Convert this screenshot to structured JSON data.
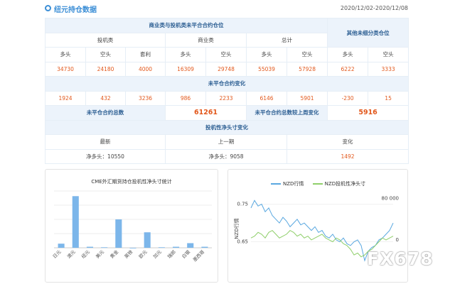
{
  "header": {
    "title": "纽元持仓数据",
    "date_range": "2020/12/02-2020/12/08"
  },
  "table": {
    "title_commercial_noncommercial": "商业类与投机类未平合合约仓位",
    "title_other": "其他未细分类仓位",
    "groups": {
      "speculative": "投机类",
      "commercial": "商业类",
      "total": "总计"
    },
    "cols": {
      "long": "多头",
      "short": "空头",
      "arb": "套利"
    },
    "row1": [
      "34730",
      "24180",
      "4000",
      "16309",
      "29748",
      "55039",
      "57928",
      "6222",
      "3333"
    ],
    "change_title": "未平仓合约变化",
    "row2": [
      "1924",
      "432",
      "3236",
      "986",
      "2233",
      "6146",
      "5901",
      "-230",
      "15"
    ],
    "oi_total_label": "未平仓合约总数",
    "oi_total_value": "61261",
    "oi_change_label": "未平仓合约总数较上周变化",
    "oi_change_value": "5916",
    "net_title": "投机性净头寸变化",
    "net_headers": [
      "最新",
      "上一期",
      "变化"
    ],
    "net_values": [
      "净多头：10550",
      "净多头：9058",
      "1492"
    ]
  },
  "chart1": {
    "title": "CME外汇期货持仓投机性净头寸统计",
    "bar_color": "#7cb6ea"
  },
  "chart2": {
    "legend": [
      "NZD行情",
      "NZD投机性净头寸"
    ],
    "colors": [
      "#5aa8e0",
      "#8fcf6a"
    ],
    "left_ticks": [
      "0.75",
      "0.65"
    ],
    "right_ticks": [
      "80 000",
      "0"
    ],
    "ylabel": "NZD行情"
  },
  "chart_data": [
    {
      "type": "bar",
      "title": "CME外汇期货持仓投机性净头寸统计",
      "categories": [
        "日元",
        "澳元",
        "纽元",
        "美元",
        "黄金",
        "英镑",
        "欧元",
        "加元",
        "瑞郎",
        "白银",
        "墨西哥"
      ],
      "values": [
        8,
        100,
        2,
        1,
        55,
        0,
        30,
        1,
        2,
        9,
        2
      ],
      "ylim": [
        0,
        110
      ]
    },
    {
      "type": "line",
      "series": [
        {
          "name": "NZD行情",
          "values": [
            0.74,
            0.76,
            0.745,
            0.75,
            0.73,
            0.74,
            0.72,
            0.71,
            0.7,
            0.715,
            0.705,
            0.69,
            0.7,
            0.71,
            0.695,
            0.7,
            0.69,
            0.68,
            0.69,
            0.675,
            0.68,
            0.665,
            0.66,
            0.67,
            0.655,
            0.65,
            0.66,
            0.645,
            0.64,
            0.65,
            0.655,
            0.64,
            0.6,
            0.625,
            0.635,
            0.64,
            0.655,
            0.66,
            0.67,
            0.68,
            0.7
          ]
        },
        {
          "name": "NZD投机性净头寸",
          "values": [
            0.66,
            0.665,
            0.675,
            0.67,
            0.66,
            0.675,
            0.68,
            0.67,
            0.66,
            0.665,
            0.67,
            0.68,
            0.675,
            0.665,
            0.67,
            0.66,
            0.665,
            0.655,
            0.66,
            0.665,
            0.67,
            0.66,
            0.655,
            0.65,
            0.66,
            0.655,
            0.645,
            0.64,
            0.63,
            0.615,
            0.62,
            0.61,
            0.615,
            0.625,
            0.63,
            0.64,
            0.65,
            0.66,
            0.655,
            0.66,
            0.665
          ]
        }
      ],
      "ylim": [
        0.6,
        0.77
      ]
    }
  ],
  "watermark": "FX678"
}
